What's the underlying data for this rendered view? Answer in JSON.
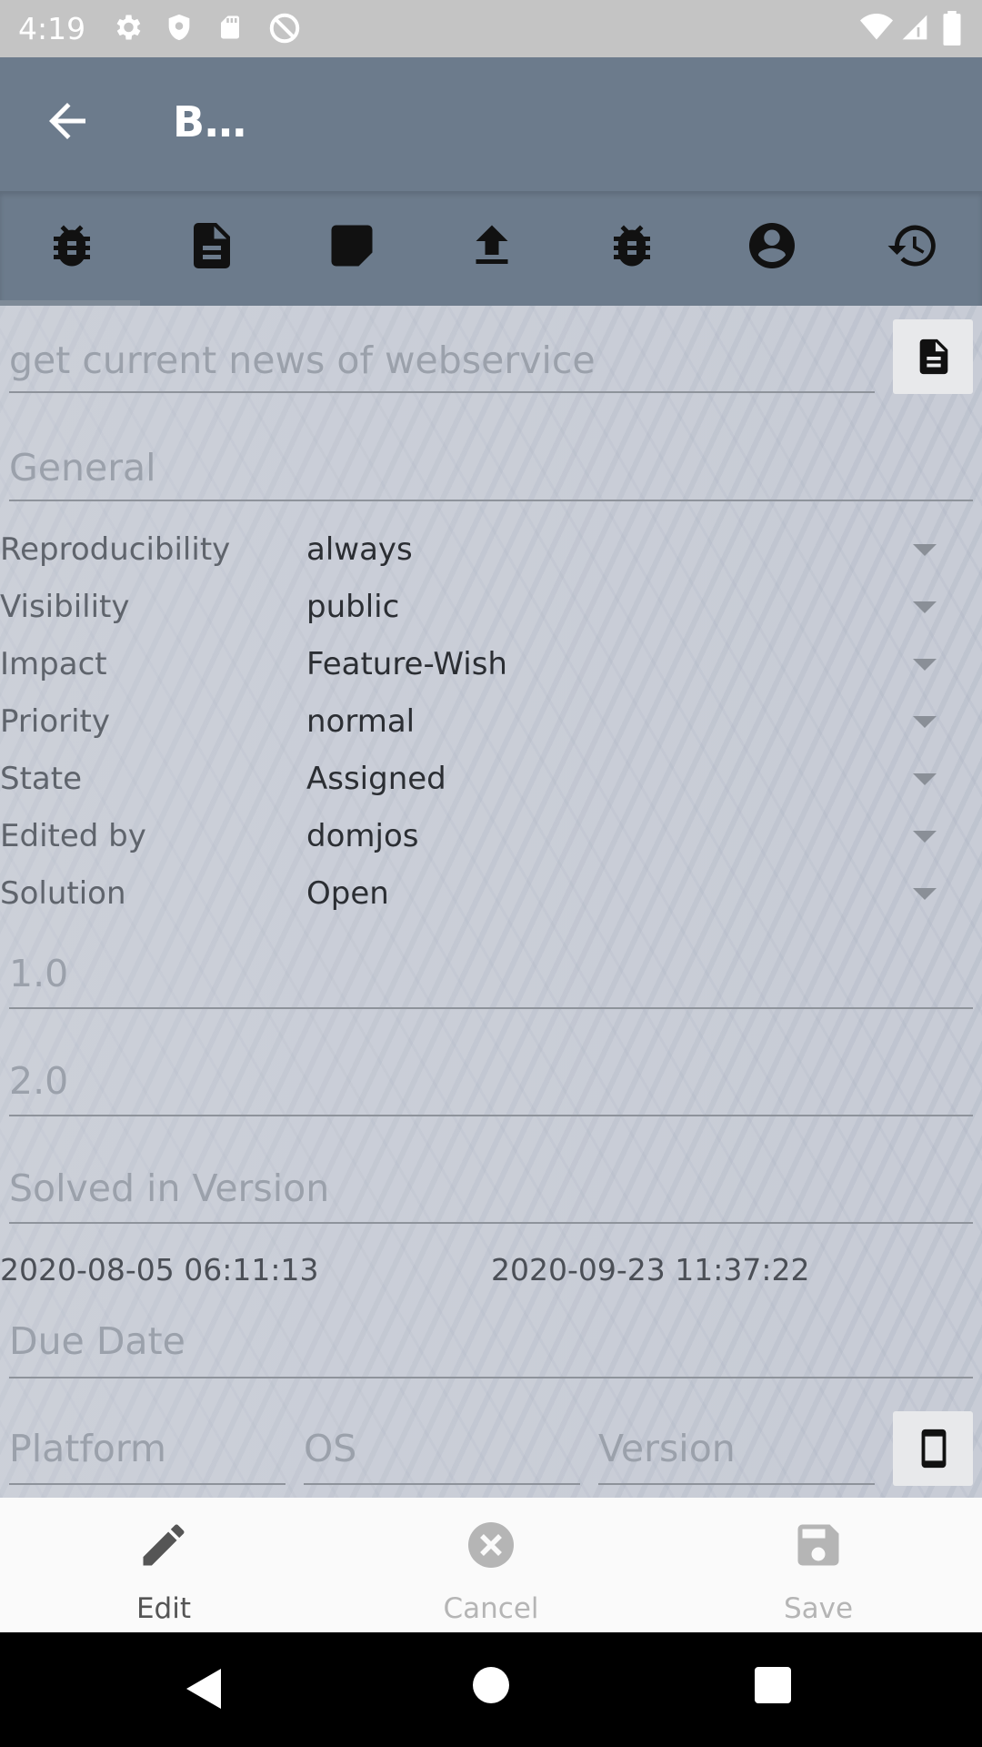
{
  "status_bar": {
    "time": "4:19",
    "icons": [
      "settings-icon",
      "shield-icon",
      "sd-card-icon",
      "no-sync-icon",
      "wifi-icon",
      "signal-icon",
      "battery-icon"
    ]
  },
  "app_bar": {
    "title": "B…",
    "back_icon": "arrow-back-icon"
  },
  "tabs": [
    {
      "icon": "bug-icon"
    },
    {
      "icon": "document-icon"
    },
    {
      "icon": "label-icon"
    },
    {
      "icon": "upload-icon"
    },
    {
      "icon": "bug-icon"
    },
    {
      "icon": "account-circle-icon"
    },
    {
      "icon": "history-icon"
    }
  ],
  "summary": {
    "value": "get current news of webservice"
  },
  "general": {
    "placeholder": "General"
  },
  "properties": [
    {
      "label": "Reproducibility",
      "value": "always"
    },
    {
      "label": "Visibility",
      "value": "public"
    },
    {
      "label": "Impact",
      "value": "Feature-Wish"
    },
    {
      "label": "Priority",
      "value": "normal"
    },
    {
      "label": "State",
      "value": "Assigned"
    },
    {
      "label": "Edited by",
      "value": "domjos"
    },
    {
      "label": "Solution",
      "value": "Open"
    }
  ],
  "versions": {
    "version": "1.0",
    "target_version": "2.0",
    "solved_placeholder": "Solved in Version"
  },
  "dates": {
    "created": "2020-08-05 06:11:13",
    "updated": "2020-09-23 11:37:22"
  },
  "due_date": {
    "placeholder": "Due Date"
  },
  "platform_fields": {
    "platform_placeholder": "Platform",
    "os_placeholder": "OS",
    "version_placeholder": "Version"
  },
  "actions": {
    "edit": "Edit",
    "cancel": "Cancel",
    "save": "Save"
  },
  "colors": {
    "app_bar": "#6c7b8c",
    "content_bg": "#c9cdd7",
    "action_active": "#555555",
    "action_disabled": "#b5b5b5"
  }
}
